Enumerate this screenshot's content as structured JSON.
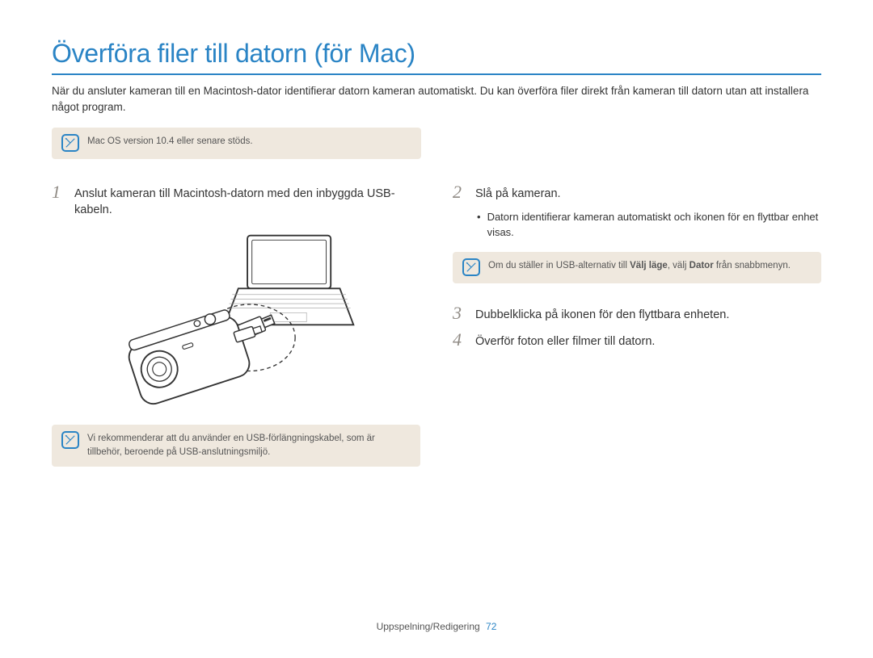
{
  "title": "Överföra filer till datorn (för Mac)",
  "intro": "När du ansluter kameran till en Macintosh-dator identifierar datorn kameran automatiskt. Du kan överföra filer direkt från kameran till datorn utan att installera något program.",
  "note_top": "Mac OS version 10.4 eller senare stöds.",
  "left": {
    "step1_num": "1",
    "step1_text": "Anslut kameran till Macintosh-datorn med den inbyggda USB-kabeln.",
    "note_bottom": "Vi rekommenderar att du använder en USB-förlängningskabel, som är tillbehör, beroende på USB-anslutningsmiljö."
  },
  "right": {
    "step2_num": "2",
    "step2_text": "Slå på kameran.",
    "step2_bullet": "Datorn identifierar kameran automatiskt och ikonen för en flyttbar enhet visas.",
    "note_mid_pre": "Om du ställer in USB-alternativ till ",
    "note_mid_b1": "Välj läge",
    "note_mid_mid": ", välj ",
    "note_mid_b2": "Dator",
    "note_mid_post": " från snabbmenyn.",
    "step3_num": "3",
    "step3_text": "Dubbelklicka på ikonen för den flyttbara enheten.",
    "step4_num": "4",
    "step4_text": "Överför foton eller filmer till datorn."
  },
  "footer_label": "Uppspelning/Redigering",
  "footer_page": "72"
}
